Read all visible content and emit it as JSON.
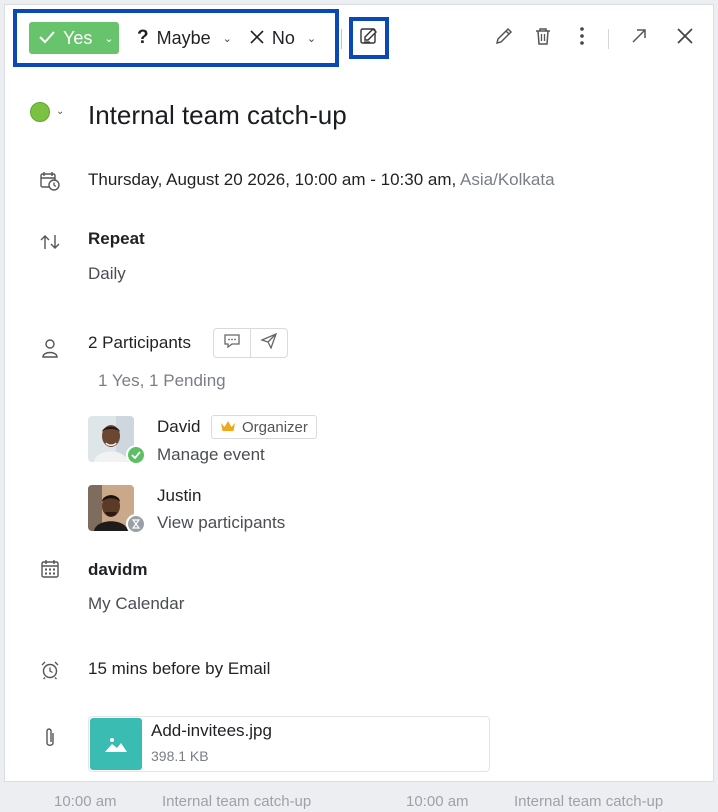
{
  "toolbar": {
    "rsvp": {
      "yes_label": "Yes",
      "maybe_label": "Maybe",
      "no_label": "No",
      "selected": "Yes"
    }
  },
  "event": {
    "title": "Internal team catch-up",
    "status_color": "#7cc242",
    "datetime": "Thursday, August 20 2026,  10:00 am  - 10:30 am,",
    "timezone": "Asia/Kolkata",
    "repeat_label": "Repeat",
    "repeat_value": "Daily",
    "participants_label": "2 Participants",
    "participants_summary": "1 Yes, 1 Pending",
    "participants": [
      {
        "name": "David",
        "role_badge": "Organizer",
        "action": "Manage event",
        "status": "yes"
      },
      {
        "name": "Justin",
        "action": "View participants",
        "status": "pending"
      }
    ],
    "calendar_owner": "davidm",
    "calendar_name": "My Calendar",
    "reminder": "15 mins before by Email",
    "attachment": {
      "name": "Add-invitees.jpg",
      "size": "398.1 KB"
    }
  },
  "background": {
    "ghost_items": [
      "10:00 am",
      "Internal team catch-up",
      "10:00 am",
      "Internal team catch-up"
    ]
  },
  "colors": {
    "accent_box": "#0a47b8",
    "yes_green": "#67c46c",
    "attachment_teal": "#3bbcb2"
  }
}
